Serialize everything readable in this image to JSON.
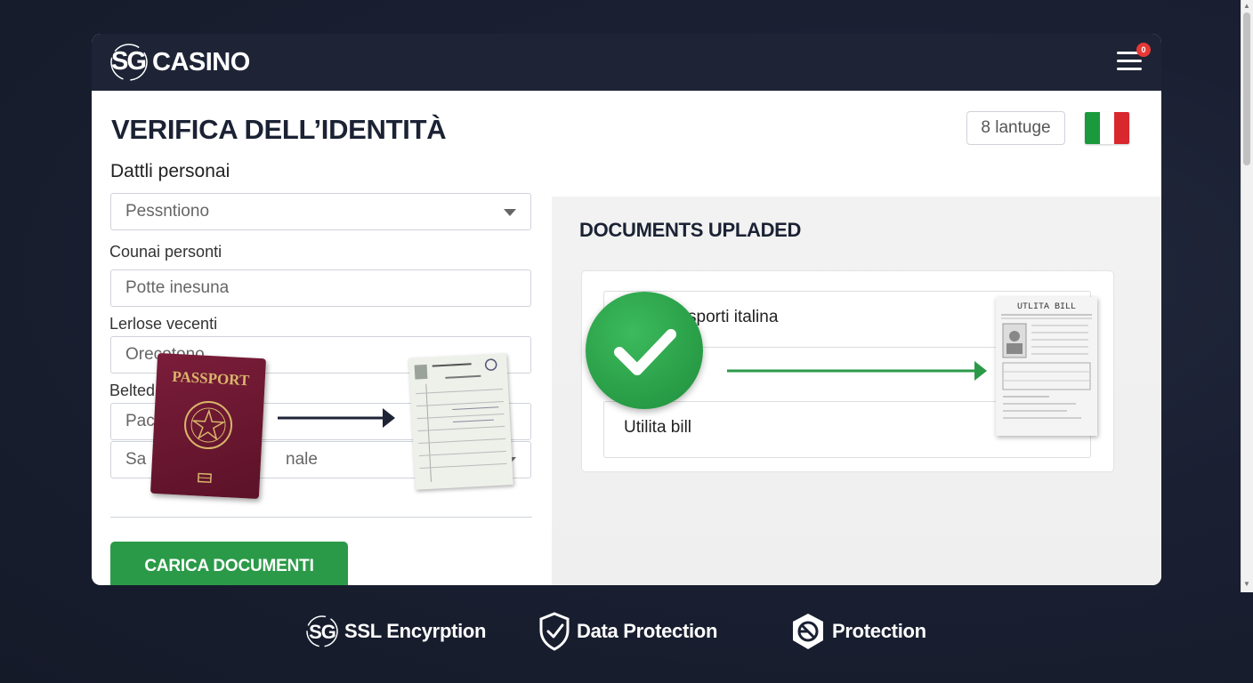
{
  "header": {
    "logo_mark": "SG",
    "logo_text": "CASINO",
    "menu_badge": "0"
  },
  "page": {
    "title": "VERIFICA DELL’IDENTITÀ",
    "language_select": "8 lantuge",
    "flag": "italy-flag"
  },
  "form": {
    "section_label": "Dattli personai",
    "select_value": "Pessntiono",
    "label_2": "Counai personti",
    "field_2_placeholder": "Potte inesuna",
    "label_3": "Lerlose vecenti",
    "field_3_value": "Orecotono",
    "label_4": "Belted",
    "field_4_value": "Pac",
    "field_5_value_start": "Sa",
    "field_5_value_end": "nale",
    "submit_label": "CARICA DOCUMENTI"
  },
  "passport": {
    "cover_text": "PASSPORT"
  },
  "documents": {
    "title": "DOCUMENTS UPLADED",
    "items": [
      {
        "label": "sporti italina"
      },
      {
        "label": "Utilita bill"
      }
    ],
    "bill_title": "UTLITA BILL"
  },
  "footer": {
    "items": [
      {
        "icon": "sg-shield-icon",
        "label": "SSL Encyrption"
      },
      {
        "icon": "shield-check-icon",
        "label": "Data Protection"
      },
      {
        "icon": "protection-badge-icon",
        "label": "Protection"
      }
    ]
  },
  "colors": {
    "background": "#1a2032",
    "topbar": "#1e2436",
    "accent_green": "#2b9a48",
    "badge_red": "#e53935"
  }
}
